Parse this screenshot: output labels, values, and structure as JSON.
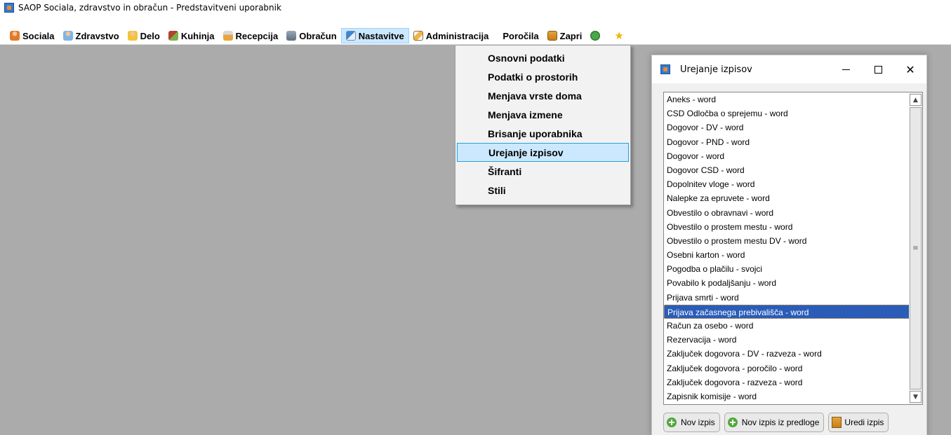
{
  "window": {
    "title": "SAOP Sociala, zdravstvo in obračun - Predstavitveni uporabnik"
  },
  "menubar": {
    "items": [
      {
        "label": "Sociala",
        "icon": "person-icon"
      },
      {
        "label": "Zdravstvo",
        "icon": "doctor-icon"
      },
      {
        "label": "Delo",
        "icon": "worker-icon"
      },
      {
        "label": "Kuhinja",
        "icon": "kitchen-icon"
      },
      {
        "label": "Recepcija",
        "icon": "reception-icon"
      },
      {
        "label": "Obračun",
        "icon": "calculator-icon"
      },
      {
        "label": "Nastavitve",
        "icon": "settings-icon"
      },
      {
        "label": "Administracija",
        "icon": "pencil-icon"
      },
      {
        "label": "Poročila",
        "icon": ""
      },
      {
        "label": "Zapri",
        "icon": "book-icon"
      }
    ],
    "extra_icons": [
      "money-icon",
      "star-icon"
    ]
  },
  "dropdown": {
    "items": [
      {
        "label": "Osnovni podatki"
      },
      {
        "label": "Podatki o prostorih"
      },
      {
        "label": "Menjava vrste doma"
      },
      {
        "label": "Menjava izmene"
      },
      {
        "label": "Brisanje uporabnika"
      },
      {
        "label": "Urejanje izpisov"
      },
      {
        "label": "Šifranti"
      },
      {
        "label": "Stili"
      }
    ],
    "selected": "Urejanje izpisov"
  },
  "dialog": {
    "title": "Urejanje izpisov",
    "list_items": [
      "Aneks - word",
      "CSD Odločba o sprejemu - word",
      "Dogovor - DV - word",
      "Dogovor - PND - word",
      "Dogovor - word",
      "Dogovor CSD - word",
      "Dopolnitev vloge - word",
      "Nalepke za epruvete - word",
      "Obvestilo o obravnavi - word",
      "Obvestilo o prostem mestu - word",
      "Obvestilo o prostem mestu DV - word",
      "Osebni karton - word",
      "Pogodba o plačilu - svojci",
      "Povabilo k podaljšanju - word",
      "Prijava smrti - word",
      "Prijava začasnega prebivališča - word",
      "Račun za osebo - word",
      "Rezervacija - word",
      "Zaključek dogovora - DV - razveza - word",
      "Zaključek dogovora - poročilo - word",
      "Zaključek dogovora - razveza - word",
      "Zapisnik komisije - word"
    ],
    "selected_item": "Prijava začasnega prebivališča - word",
    "buttons": {
      "new": "Nov izpis",
      "new_from_template": "Nov izpis iz predloge",
      "edit": "Uredi izpis"
    }
  }
}
